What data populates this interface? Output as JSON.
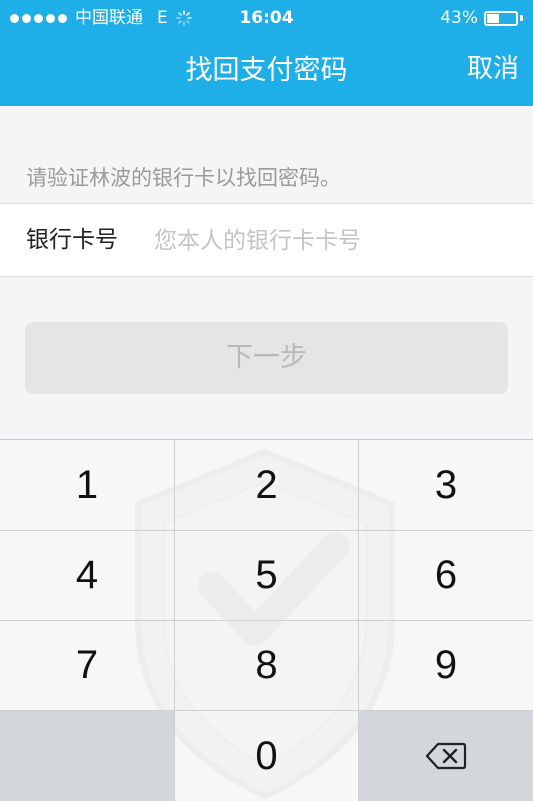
{
  "status_bar": {
    "carrier": "中国联通",
    "network": "E",
    "time": "16:04",
    "battery_text": "43%",
    "battery_level": 0.43,
    "signal_bars": 5
  },
  "nav": {
    "title": "找回支付密码",
    "cancel_label": "取消"
  },
  "form": {
    "hint": "请验证林波的银行卡以找回密码。",
    "card_label": "银行卡号",
    "card_value": "",
    "card_placeholder": "您本人的银行卡卡号",
    "next_label": "下一步"
  },
  "keypad": {
    "keys": [
      "1",
      "2",
      "3",
      "4",
      "5",
      "6",
      "7",
      "8",
      "9",
      "0"
    ],
    "delete_icon": "backspace-icon"
  },
  "colors": {
    "accent": "#1eaee8",
    "button_disabled": "#e5e5e7",
    "keypad_gray": "#d3d6da"
  }
}
